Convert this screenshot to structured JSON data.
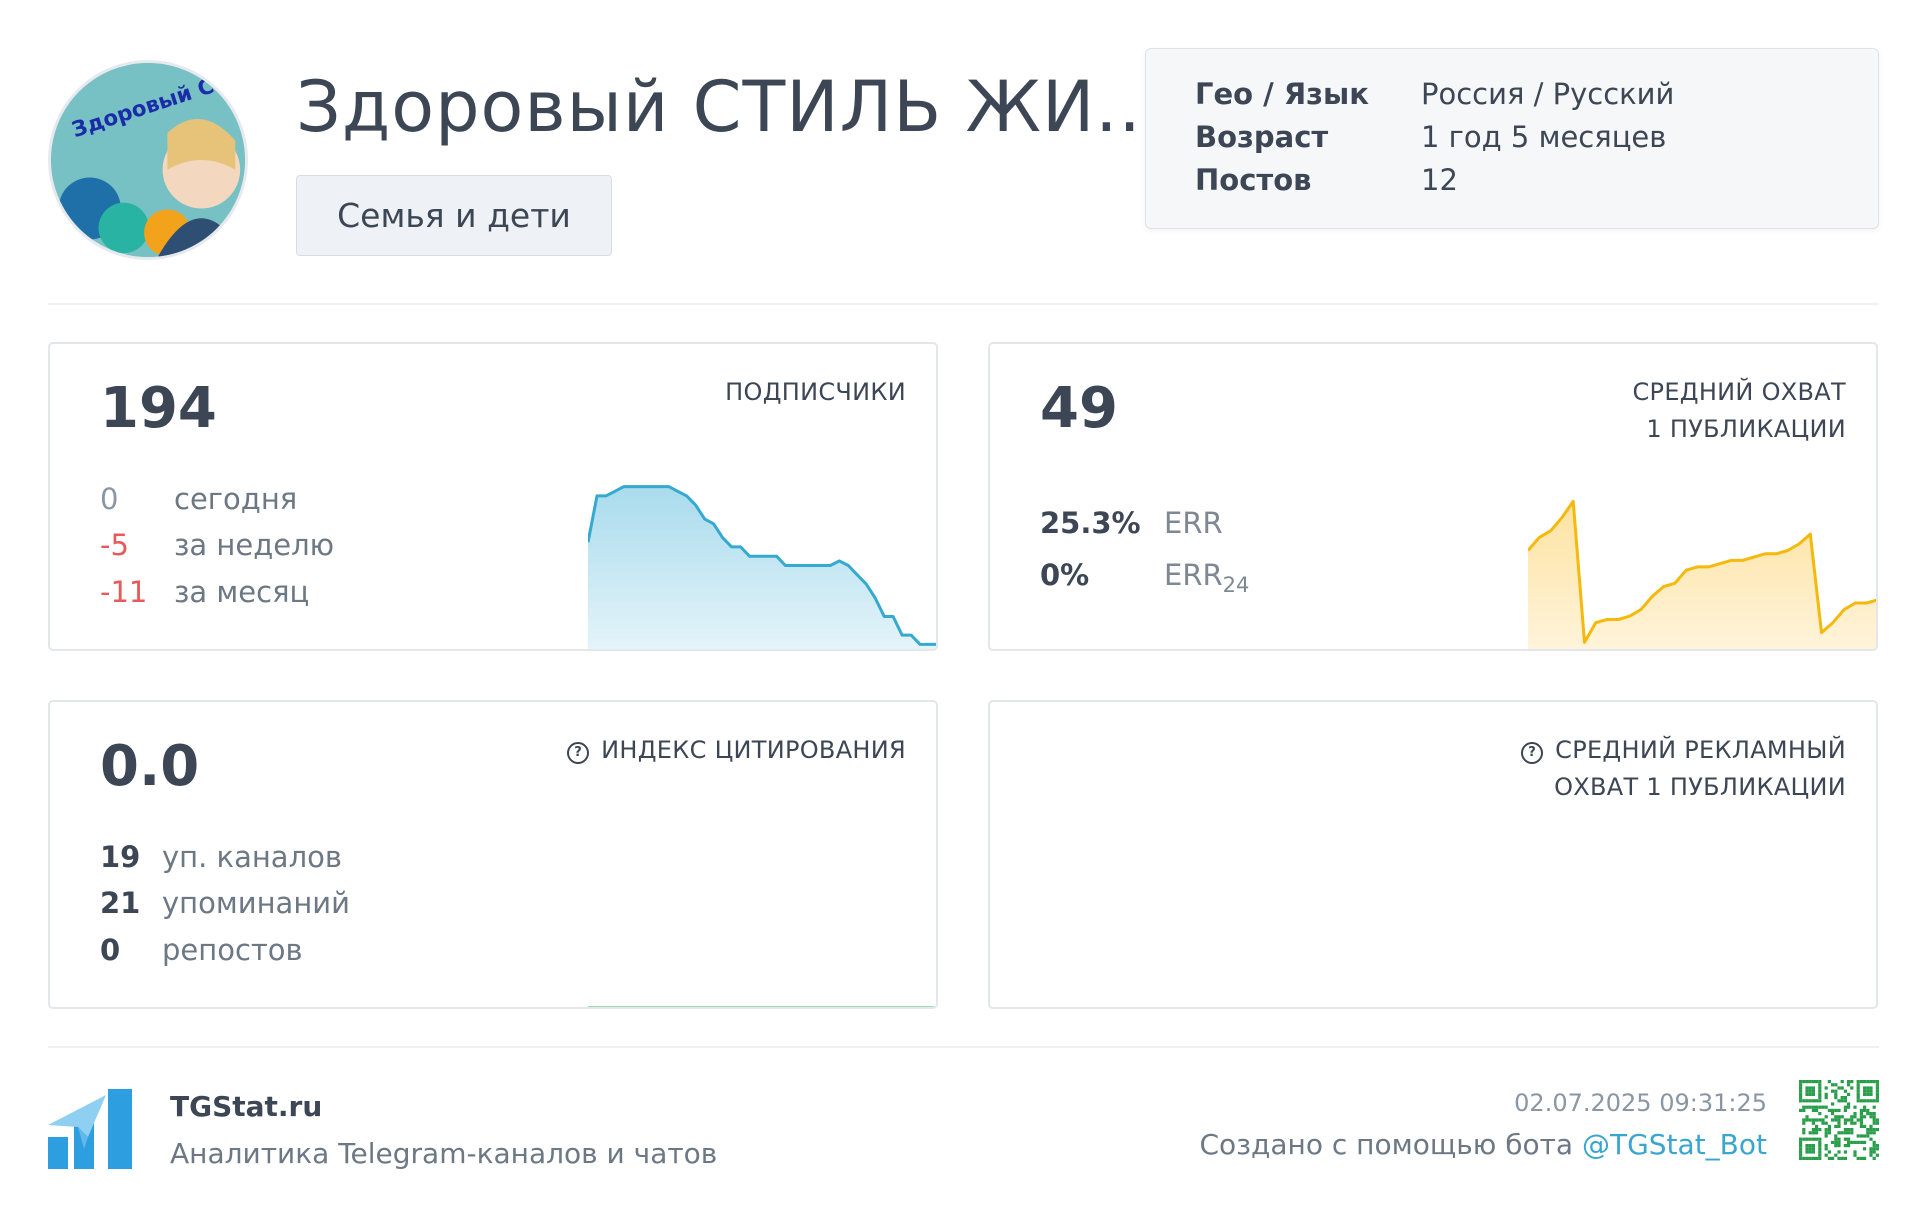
{
  "channel": {
    "title": "Здоровый СТИЛЬ ЖИ...",
    "category": "Семья и дети",
    "avatar_text": "Здоровый СТИЛЬ ЖИЗНИ"
  },
  "info": [
    {
      "key": "Гео / Язык",
      "value": "Россия / Русский"
    },
    {
      "key": "Возраст",
      "value": "1 год 5 месяцев"
    },
    {
      "key": "Постов",
      "value": "12"
    }
  ],
  "subscribers": {
    "label": "ПОДПИСЧИКИ",
    "value": "194",
    "rows": [
      {
        "num": "0",
        "label": "сегодня"
      },
      {
        "num": "-5",
        "label": "за неделю"
      },
      {
        "num": "-11",
        "label": "за месяц"
      }
    ]
  },
  "reach": {
    "label_line1": "СРЕДНИЙ ОХВАТ",
    "label_line2": "1 ПУБЛИКАЦИИ",
    "value": "49",
    "err_value": "25.3%",
    "err_label": "ERR",
    "err24_value": "0%",
    "err24_label": "ERR",
    "err24_sub": "24"
  },
  "citation": {
    "label": "ИНДЕКС ЦИТИРОВАНИЯ",
    "value": "0.0",
    "rows": [
      {
        "num": "19",
        "label": "уп. каналов"
      },
      {
        "num": "21",
        "label": "упоминаний"
      },
      {
        "num": "0",
        "label": "репостов"
      }
    ]
  },
  "ad_reach": {
    "label_line1": "СРЕДНИЙ РЕКЛАМНЫЙ",
    "label_line2": "ОХВАТ 1 ПУБЛИКАЦИИ"
  },
  "footer": {
    "brand": "TGStat.ru",
    "tagline": "Аналитика Telegram-каналов и чатов",
    "timestamp": "02.07.2025 09:31:25",
    "created_with": "Создано с помощью бота",
    "bot": "@TGStat_Bot"
  },
  "colors": {
    "subscribers_line": "#35a9d0",
    "reach_line": "#f5b90c",
    "citation_line": "#3cb95b",
    "negative": "#e85a5a",
    "link": "#3aa6d0",
    "logo": "#2d9fe0"
  },
  "chart_data": [
    {
      "type": "area",
      "name": "subscribers-sparkline",
      "values": [
        180,
        190,
        190,
        191,
        192,
        192,
        192,
        192,
        192,
        192,
        191,
        190,
        188,
        185,
        184,
        181,
        179,
        179,
        177,
        177,
        177,
        177,
        175,
        175,
        175,
        175,
        175,
        175,
        176,
        175,
        173,
        171,
        168,
        164,
        164,
        160,
        160,
        158,
        158,
        158
      ]
    },
    {
      "type": "area",
      "name": "reach-sparkline",
      "values": [
        30,
        34,
        36,
        40,
        45,
        2,
        8,
        9,
        9,
        10,
        12,
        16,
        19,
        20,
        24,
        25,
        25,
        26,
        27,
        27,
        28,
        29,
        29,
        30,
        32,
        35,
        5,
        8,
        12,
        14,
        14,
        15
      ]
    },
    {
      "type": "line",
      "name": "citation-sparkline",
      "values": [
        0,
        0,
        0,
        0,
        0,
        0,
        0,
        0,
        0,
        0
      ]
    }
  ]
}
